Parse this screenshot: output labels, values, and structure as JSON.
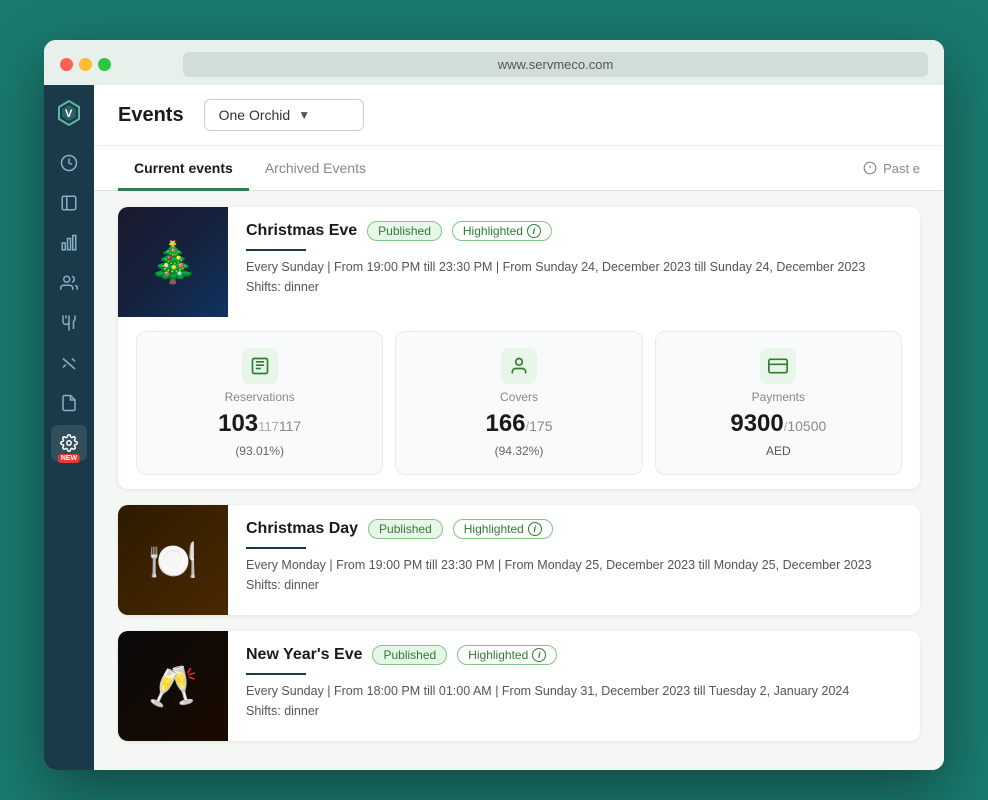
{
  "browser": {
    "url": "www.servmeco.com"
  },
  "header": {
    "title": "Events",
    "venue_label": "One Orchid"
  },
  "tabs": {
    "current_label": "Current events",
    "archived_label": "Archived Events",
    "past_events_label": "Past e"
  },
  "sidebar": {
    "logo": "V",
    "items": [
      {
        "name": "history",
        "icon": "⏱"
      },
      {
        "name": "contacts",
        "icon": "👤"
      },
      {
        "name": "analytics",
        "icon": "📊"
      },
      {
        "name": "users",
        "icon": "👥"
      },
      {
        "name": "fork",
        "icon": "🍴"
      },
      {
        "name": "tools",
        "icon": "✂️"
      },
      {
        "name": "documents",
        "icon": "📄"
      },
      {
        "name": "settings",
        "icon": "⚙️",
        "badge": "NEW"
      }
    ]
  },
  "events": [
    {
      "id": "christmas-eve",
      "title": "Christmas Eve",
      "status": "Published",
      "highlighted": "Highlighted",
      "schedule": "Every Sunday | From 19:00 PM till 23:30 PM | From Sunday 24, December 2023 till Sunday 24, December 2023",
      "shifts": "Shifts: dinner",
      "stats": {
        "reservations": {
          "label": "Reservations",
          "current": "103",
          "total": "117",
          "percent": "(93.01%)",
          "icon": "📋"
        },
        "covers": {
          "label": "Covers",
          "current": "166",
          "total": "175",
          "percent": "(94.32%)",
          "icon": "👤"
        },
        "payments": {
          "label": "Payments",
          "current": "9300",
          "total": "10500",
          "currency": "AED",
          "icon": "💳"
        }
      }
    },
    {
      "id": "christmas-day",
      "title": "Christmas Day",
      "status": "Published",
      "highlighted": "Highlighted",
      "schedule": "Every Monday | From 19:00 PM till 23:30 PM | From Monday 25, December 2023 till Monday 25, December 2023",
      "shifts": "Shifts: dinner"
    },
    {
      "id": "new-years-eve",
      "title": "New Year's Eve",
      "status": "Published",
      "highlighted": "Highlighted",
      "schedule": "Every Sunday | From 18:00 PM till 01:00 AM | From Sunday 31, December 2023 till Tuesday 2, January 2024",
      "shifts": "Shifts: dinner"
    }
  ]
}
